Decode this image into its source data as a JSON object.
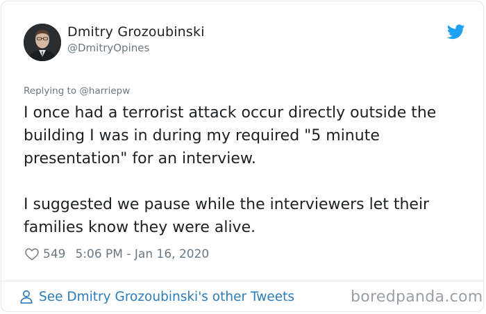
{
  "author": {
    "name": "Dmitry Grozoubinski",
    "handle": "@DmitryOpines"
  },
  "reply": {
    "prefix": "Replying to ",
    "to": "@harriepw"
  },
  "tweet": {
    "paragraphs": [
      "I once had a terrorist attack occur directly outside the building I was in during my required \"5 minute presentation\" for an interview.",
      "I suggested we pause while the interviewers let their families know they were alive."
    ]
  },
  "meta": {
    "likes": "549",
    "timestamp": "5:06 PM - Jan 16, 2020"
  },
  "footer": {
    "see_more": "See Dmitry Grozoubinski's other Tweets"
  },
  "watermark": "boredpanda.com",
  "icons": {
    "bird": "twitter-bird-icon",
    "heart": "heart-icon",
    "person": "person-icon"
  },
  "colors": {
    "text": "#1c2022",
    "muted": "#697882",
    "link": "#2b7bb9",
    "twitter_blue": "#1da1f2",
    "border": "#e1e8ed"
  }
}
